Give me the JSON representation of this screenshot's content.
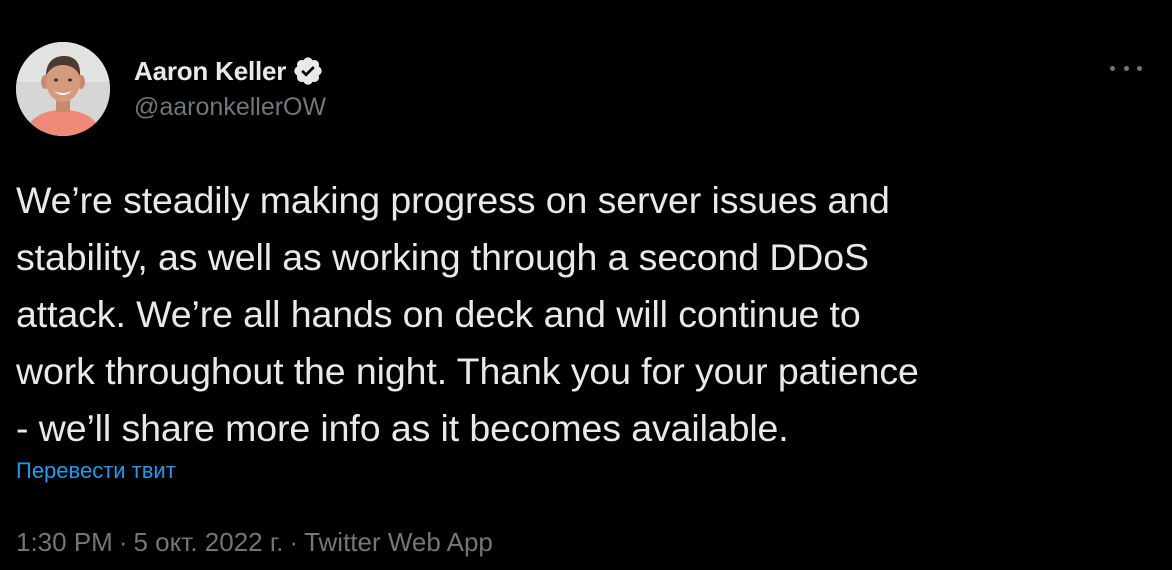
{
  "author": {
    "display_name": "Aaron Keller",
    "handle": "@aaronkellerOW",
    "verified": true,
    "verified_icon": "verified-badge-icon",
    "avatar_icon": "profile-photo"
  },
  "more_menu_icon": "more-options-icon",
  "tweet": {
    "lines": [
      "We’re steadily making progress on server issues and",
      "stability, as well as working through a second DDoS",
      "attack. We’re all hands on deck and will continue to",
      "work throughout the night. Thank you for your patience",
      "- we’ll share more info as it becomes available."
    ],
    "translate_label": "Перевести твит"
  },
  "meta": {
    "time": "1:30 PM",
    "separator": "·",
    "date": "5 окт. 2022 г.",
    "source": "Twitter Web App"
  },
  "colors": {
    "background": "#000000",
    "primary_text": "#e7e9ea",
    "secondary_text": "#71767b",
    "link": "#1d9bf0"
  }
}
